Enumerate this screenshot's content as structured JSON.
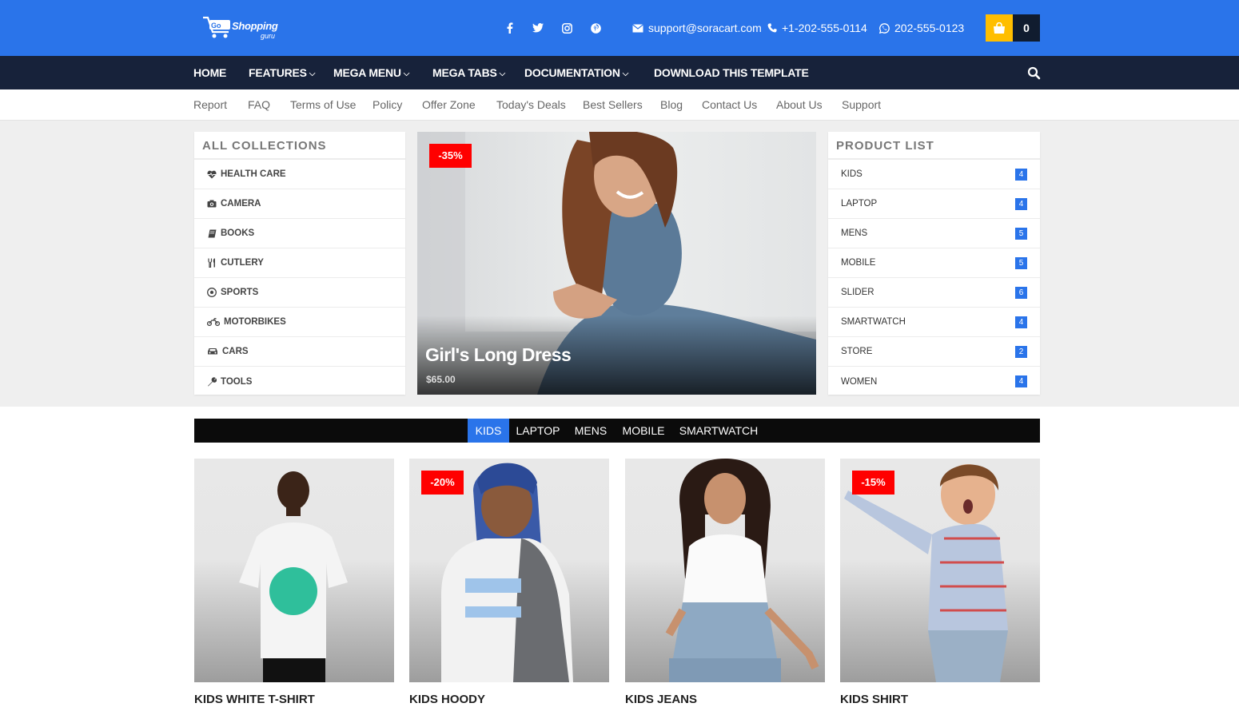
{
  "header": {
    "logo_text": "Go Shopping",
    "logo_sub": "guru",
    "social": [
      {
        "icon": "facebook-icon",
        "glyph": "f"
      },
      {
        "icon": "twitter-icon",
        "glyph": ""
      },
      {
        "icon": "instagram-icon",
        "glyph": ""
      },
      {
        "icon": "pinterest-icon",
        "glyph": ""
      }
    ],
    "email": "support@soracart.com",
    "phone": "+1-202-555-0114",
    "whatsapp": "202-555-0123",
    "cart_count": "0"
  },
  "main_nav": {
    "items": [
      "HOME",
      "FEATURES",
      "MEGA MENU",
      "MEGA TABS",
      "DOCUMENTATION",
      "DOWNLOAD THIS TEMPLATE"
    ]
  },
  "sub_nav": {
    "items": [
      "Report",
      "FAQ",
      "Terms of Use",
      "Policy",
      "Offer Zone",
      "Today's Deals",
      "Best Sellers",
      "Blog",
      "Contact Us",
      "About Us",
      "Support"
    ]
  },
  "collections": {
    "title": "ALL COLLECTIONS",
    "items": [
      {
        "label": "HEALTH CARE",
        "icon": "heartbeat-icon"
      },
      {
        "label": "CAMERA",
        "icon": "camera-icon"
      },
      {
        "label": "BOOKS",
        "icon": "book-icon"
      },
      {
        "label": "CUTLERY",
        "icon": "cutlery-icon"
      },
      {
        "label": "SPORTS",
        "icon": "soccer-ball-icon"
      },
      {
        "label": "MOTORBIKES",
        "icon": "motorcycle-icon"
      },
      {
        "label": "CARS",
        "icon": "car-icon"
      },
      {
        "label": "TOOLS",
        "icon": "wrench-icon"
      }
    ]
  },
  "featured": {
    "discount": "-35%",
    "title": "Girl's Long Dress",
    "price": "$65.00"
  },
  "product_list": {
    "title": "PRODUCT LIST",
    "items": [
      {
        "label": "KIDS",
        "count": "4"
      },
      {
        "label": "LAPTOP",
        "count": "4"
      },
      {
        "label": "MENS",
        "count": "5"
      },
      {
        "label": "MOBILE",
        "count": "5"
      },
      {
        "label": "SLIDER",
        "count": "6"
      },
      {
        "label": "SMARTWATCH",
        "count": "4"
      },
      {
        "label": "STORE",
        "count": "2"
      },
      {
        "label": "WOMEN",
        "count": "4"
      }
    ]
  },
  "tabs": {
    "items": [
      "KIDS",
      "LAPTOP",
      "MENS",
      "MOBILE",
      "SMARTWATCH"
    ],
    "active": "KIDS"
  },
  "products": [
    {
      "name": "KIDS WHITE T-SHIRT",
      "discount": ""
    },
    {
      "name": "KIDS HOODY",
      "discount": "-20%"
    },
    {
      "name": "KIDS JEANS",
      "discount": ""
    },
    {
      "name": "KIDS SHIRT",
      "discount": "-15%"
    }
  ],
  "colors": {
    "brand_blue": "#2a74ea",
    "nav_dark": "#17223a",
    "cart_yellow": "#ffbe00",
    "sale_red": "#ff0000"
  }
}
